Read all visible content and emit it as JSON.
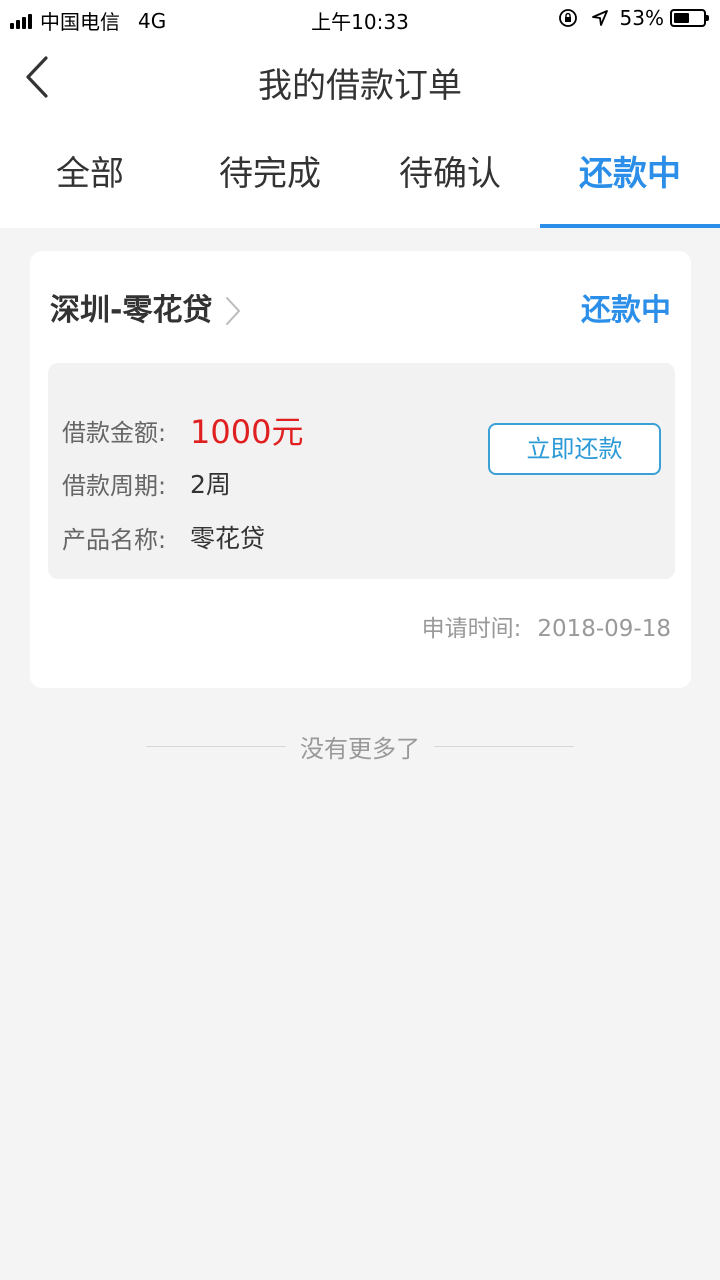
{
  "status_bar": {
    "carrier": "中国电信",
    "network": "4G",
    "time": "上午10:33",
    "battery_percent": "53%",
    "battery_level": 0.53
  },
  "header": {
    "title": "我的借款订单"
  },
  "tabs": [
    {
      "label": "全部",
      "active": false
    },
    {
      "label": "待完成",
      "active": false
    },
    {
      "label": "待确认",
      "active": false
    },
    {
      "label": "还款中",
      "active": true
    }
  ],
  "order": {
    "title": "深圳-零花贷",
    "status": "还款中",
    "rows": [
      {
        "label": "借款金额:",
        "value": "1000元"
      },
      {
        "label": "借款周期:",
        "value": "2周"
      },
      {
        "label": "产品名称:",
        "value": "零花贷"
      }
    ],
    "repay_button": "立即还款",
    "apply_time_label": "申请时间:",
    "apply_time": "2018-09-18"
  },
  "list_end_text": "没有更多了",
  "colors": {
    "accent": "#2b8ee8",
    "amount": "#e02020",
    "background": "#f4f4f4"
  },
  "icons": {
    "back": "chevron-left-icon",
    "title_arrow": "chevron-right-icon"
  }
}
